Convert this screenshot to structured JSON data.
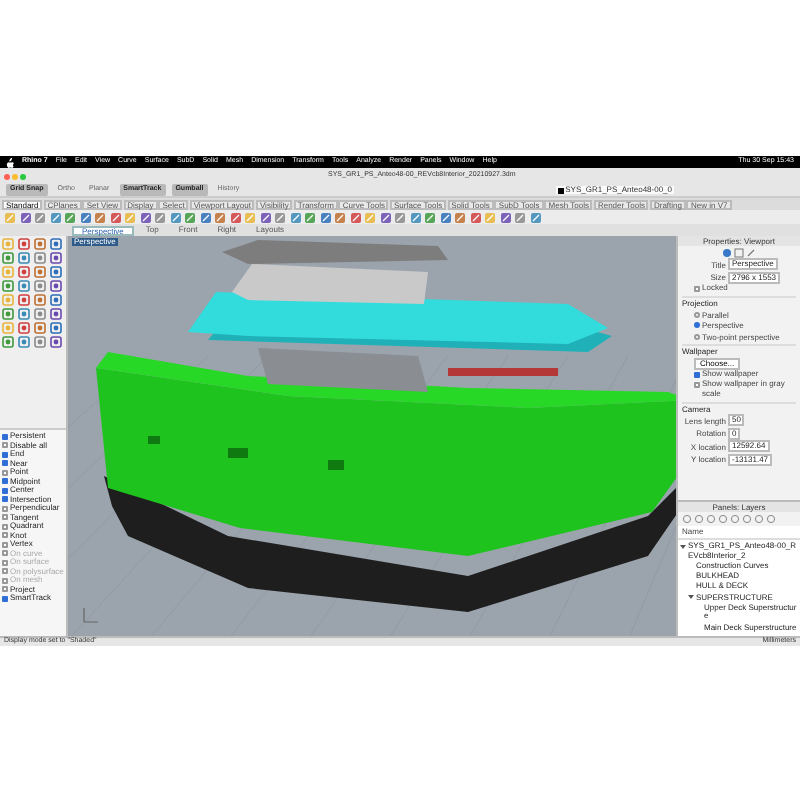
{
  "menu_bar": {
    "items": [
      "Rhino 7",
      "File",
      "Edit",
      "View",
      "Curve",
      "Surface",
      "SubD",
      "Solid",
      "Mesh",
      "Dimension",
      "Transform",
      "Tools",
      "Analyze",
      "Render",
      "Panels",
      "Window",
      "Help"
    ],
    "clock": "Thu 30 Sep 15:43"
  },
  "window": {
    "title": "SYS_GR1_PS_Anteo48-00_REVcb8Interior_20210927.3dm"
  },
  "toolbar": {
    "toggles": [
      {
        "label": "Grid Snap",
        "on": true
      },
      {
        "label": "Ortho",
        "on": false
      },
      {
        "label": "Planar",
        "on": false
      },
      {
        "label": "SmartTrack",
        "on": true
      },
      {
        "label": "Gumball",
        "on": true
      },
      {
        "label": "History",
        "on": false
      }
    ],
    "current_layer": "SYS_GR1_PS_Anteo48-00_0"
  },
  "toolbar_tabs": [
    {
      "label": "Standard",
      "selected": true
    },
    {
      "label": "CPlanes",
      "selected": false
    },
    {
      "label": "Set View",
      "selected": false
    },
    {
      "label": "Display",
      "selected": false
    },
    {
      "label": "Select",
      "selected": false
    },
    {
      "label": "Viewport Layout",
      "selected": false
    },
    {
      "label": "Visibility",
      "selected": false
    },
    {
      "label": "Transform",
      "selected": false
    },
    {
      "label": "Curve Tools",
      "selected": false
    },
    {
      "label": "Surface Tools",
      "selected": false
    },
    {
      "label": "Solid Tools",
      "selected": false
    },
    {
      "label": "SubD Tools",
      "selected": false
    },
    {
      "label": "Mesh Tools",
      "selected": false
    },
    {
      "label": "Render Tools",
      "selected": false
    },
    {
      "label": "Drafting",
      "selected": false
    },
    {
      "label": "New in V7",
      "selected": false
    }
  ],
  "viewport_tabs": [
    {
      "label": "Perspective",
      "selected": true
    },
    {
      "label": "Top",
      "selected": false
    },
    {
      "label": "Front",
      "selected": false
    },
    {
      "label": "Right",
      "selected": false
    },
    {
      "label": "Layouts",
      "selected": false
    }
  ],
  "viewport": {
    "label": "Perspective"
  },
  "osnap": [
    {
      "label": "Persistent",
      "checked": true,
      "disabled": false
    },
    {
      "label": "Disable all",
      "checked": false,
      "disabled": false
    },
    {
      "label": "End",
      "checked": true,
      "disabled": false
    },
    {
      "label": "Near",
      "checked": true,
      "disabled": false
    },
    {
      "label": "Point",
      "checked": false,
      "disabled": false
    },
    {
      "label": "Midpoint",
      "checked": true,
      "disabled": false
    },
    {
      "label": "Center",
      "checked": true,
      "disabled": false
    },
    {
      "label": "Intersection",
      "checked": true,
      "disabled": false
    },
    {
      "label": "Perpendicular",
      "checked": false,
      "disabled": false
    },
    {
      "label": "Tangent",
      "checked": false,
      "disabled": false
    },
    {
      "label": "Quadrant",
      "checked": false,
      "disabled": false
    },
    {
      "label": "Knot",
      "checked": false,
      "disabled": false
    },
    {
      "label": "Vertex",
      "checked": false,
      "disabled": false
    },
    {
      "label": "On curve",
      "checked": false,
      "disabled": true
    },
    {
      "label": "On surface",
      "checked": false,
      "disabled": true
    },
    {
      "label": "On polysurface",
      "checked": false,
      "disabled": true
    },
    {
      "label": "On mesh",
      "checked": false,
      "disabled": true
    },
    {
      "label": "Project",
      "checked": false,
      "disabled": false
    },
    {
      "label": "SmartTrack",
      "checked": true,
      "disabled": false
    }
  ],
  "properties": {
    "title": "Properties: Viewport",
    "fields": [
      {
        "label": "Title",
        "value": "Perspective"
      },
      {
        "label": "Size",
        "value": "2796 x 1553"
      }
    ],
    "locked": {
      "label": "Locked",
      "checked": false
    },
    "projection": {
      "heading": "Projection",
      "options": [
        {
          "label": "Parallel",
          "selected": false
        },
        {
          "label": "Perspective",
          "selected": true
        },
        {
          "label": "Two-point perspective",
          "selected": false
        }
      ]
    },
    "wallpaper": {
      "heading": "Wallpaper",
      "button": "Choose...",
      "options": [
        {
          "label": "Show wallpaper",
          "checked": true
        },
        {
          "label": "Show wallpaper in gray scale",
          "checked": false
        }
      ]
    },
    "camera": {
      "heading": "Camera",
      "fields": [
        {
          "label": "Lens length",
          "value": "50"
        },
        {
          "label": "Rotation",
          "value": "0"
        },
        {
          "label": "X location",
          "value": "12592.64"
        },
        {
          "label": "Y location",
          "value": "-13131.47"
        }
      ]
    }
  },
  "layers": {
    "title": "Panels: Layers",
    "column": "Name",
    "tree": [
      {
        "label": "SYS_GR1_PS_Anteo48-00_REVcb8Interior_2",
        "expanded": true,
        "children": [
          {
            "label": "Construction Curves"
          },
          {
            "label": "BULKHEAD"
          },
          {
            "label": "HULL & DECK"
          },
          {
            "label": "SUPERSTRUCTURE",
            "expanded": true,
            "children": [
              {
                "label": "Upper Deck Superstructure"
              },
              {
                "label": "Main Deck Superstructure"
              }
            ]
          }
        ]
      }
    ]
  },
  "status_bar": {
    "message": "Display mode set to \"Shaded\"",
    "units": "Millimeters"
  }
}
